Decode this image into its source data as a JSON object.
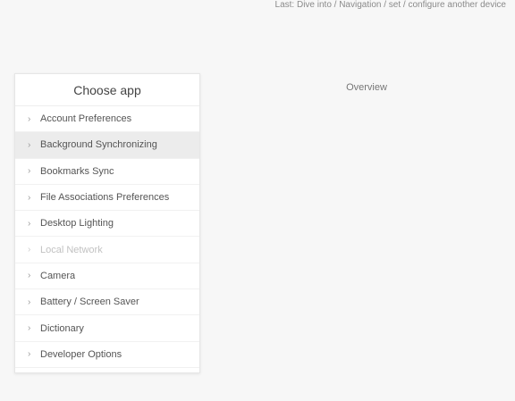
{
  "header": {
    "note": "Last: Dive into / Navigation / set / configure another device"
  },
  "app_list": {
    "title": "Choose app",
    "items": [
      {
        "bullet": "›",
        "label": "Account Preferences",
        "state": "normal"
      },
      {
        "bullet": "›",
        "label": "Background Synchronizing",
        "state": "selected"
      },
      {
        "bullet": "›",
        "label": "Bookmarks Sync",
        "state": "normal"
      },
      {
        "bullet": "›",
        "label": "File Associations Preferences",
        "state": "normal"
      },
      {
        "bullet": "›",
        "label": "Desktop Lighting",
        "state": "normal"
      },
      {
        "bullet": "›",
        "label": "Local Network",
        "state": "disabled"
      },
      {
        "bullet": "›",
        "label": "Camera",
        "state": "normal"
      },
      {
        "bullet": "›",
        "label": "Battery / Screen Saver",
        "state": "normal"
      },
      {
        "bullet": "›",
        "label": "Dictionary",
        "state": "normal"
      },
      {
        "bullet": "›",
        "label": "Developer Options",
        "state": "normal"
      }
    ]
  },
  "panel": {
    "heading": "Overview"
  }
}
